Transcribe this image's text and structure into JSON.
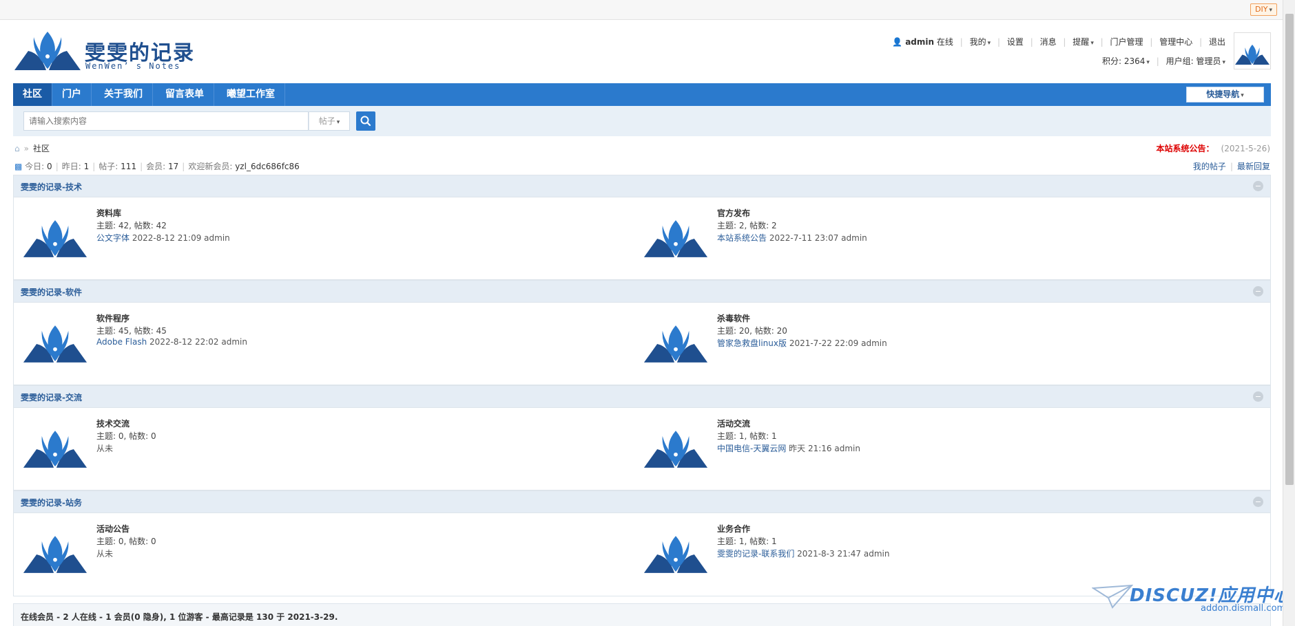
{
  "topbar": {
    "diy_label": "DIY"
  },
  "brand": {
    "title": "雯雯的记录",
    "subtitle": "WenWen’ s Notes"
  },
  "user": {
    "name": "admin",
    "status": "在线",
    "menu": [
      "我的",
      "设置",
      "消息",
      "提醒",
      "门户管理",
      "管理中心",
      "退出"
    ],
    "credits": "积分: 2364",
    "group": "用户组: 管理员"
  },
  "nav": {
    "items": [
      "社区",
      "门户",
      "关于我们",
      "留言表单",
      "曦望工作室"
    ],
    "quick_nav": "快捷导航"
  },
  "search": {
    "placeholder": "请输入搜索内容",
    "type": "帖子"
  },
  "breadcrumb": {
    "current": "社区"
  },
  "notice": {
    "label": "本站系统公告：",
    "date": "(2021-5-26)"
  },
  "stats": {
    "today_label": "今日:",
    "today": "0",
    "yesterday_label": "昨日:",
    "yesterday": "1",
    "posts_label": "帖子:",
    "posts": "111",
    "members_label": "会员:",
    "members": "17",
    "newest_label": "欢迎新会员:",
    "newest": "yzl_6dc686fc86"
  },
  "links": {
    "my_posts": "我的帖子",
    "latest_replies": "最新回复"
  },
  "sections": [
    {
      "title": "雯雯的记录-技术",
      "forums": [
        {
          "name": "资料库",
          "counts": "主题: 42, 帖数: 42",
          "last_link": "公文字体",
          "last_meta": "2022-8-12 21:09 admin"
        },
        {
          "name": "官方发布",
          "counts": "主题: 2, 帖数: 2",
          "last_link": "本站系统公告",
          "last_meta": "2022-7-11 23:07 admin"
        }
      ]
    },
    {
      "title": "雯雯的记录-软件",
      "forums": [
        {
          "name": "软件程序",
          "counts": "主题: 45, 帖数: 45",
          "last_link": "Adobe Flash",
          "last_meta": "2022-8-12 22:02 admin"
        },
        {
          "name": "杀毒软件",
          "counts": "主题: 20, 帖数: 20",
          "last_link": "管家急救盘linux版",
          "last_meta": "2021-7-22 22:09 admin"
        }
      ]
    },
    {
      "title": "雯雯的记录-交流",
      "forums": [
        {
          "name": "技术交流",
          "counts": "主题: 0, 帖数: 0",
          "last_link": "",
          "last_meta": "从未"
        },
        {
          "name": "活动交流",
          "counts": "主题: 1, 帖数: 1",
          "last_link": "中国电信-天翼云网",
          "last_meta": "昨天 21:16 admin"
        }
      ]
    },
    {
      "title": "雯雯的记录-站务",
      "forums": [
        {
          "name": "活动公告",
          "counts": "主题: 0, 帖数: 0",
          "last_link": "",
          "last_meta": "从未"
        },
        {
          "name": "业务合作",
          "counts": "主题: 1, 帖数: 1",
          "last_link": "雯雯的记录-联系我们",
          "last_meta": "2021-8-3 21:47 admin"
        }
      ]
    }
  ],
  "online": {
    "text": "在线会员 - 2 人在线 - 1 会员(0 隐身), 1 位游客 - 最高记录是 130 于 2021-3-29."
  },
  "watermark": {
    "brand": "DISCUZ!应用中心",
    "url": "addon.dismall.com"
  },
  "colors": {
    "nav": "#2b7acd",
    "nav_active": "#1a5ba6",
    "link": "#2b5d99",
    "section_head": "#e5edf5",
    "notice": "#dd0000"
  }
}
